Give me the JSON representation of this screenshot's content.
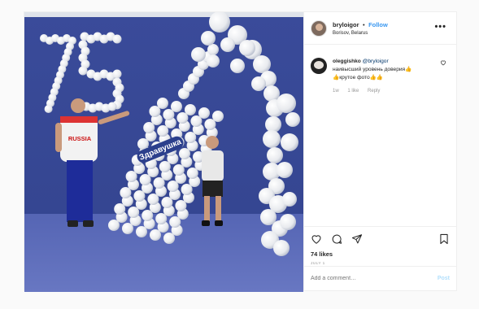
{
  "post": {
    "author": {
      "username": "bryloigor",
      "separator": "•",
      "follow_label": "Follow",
      "location": "Borisov, Belarus"
    },
    "more_icon": "more-horizontal-icon",
    "photo": {
      "balloon_number": "75",
      "bottle_label": "Здравушка",
      "shirt_text": "RUSSIA"
    },
    "comment": {
      "username": "oleggishko",
      "mention": "@bryloigor",
      "line1": "наивысший уровень доверия👍",
      "line2": "👍крутое фото👍👍",
      "time": "1w",
      "likes": "1 like",
      "reply": "Reply"
    },
    "likes_count": "74 likes",
    "date": "July 1",
    "add_comment_placeholder": "Add a comment…",
    "post_button": "Post",
    "colors": {
      "link_blue": "#3897f0",
      "post_disabled": "#b2dffc",
      "wall": "#3d4fa0"
    }
  }
}
